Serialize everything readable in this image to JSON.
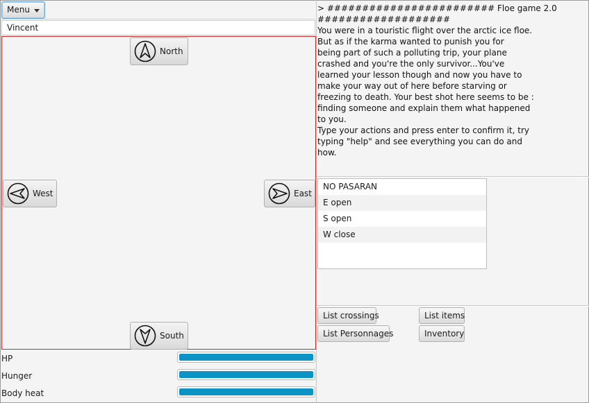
{
  "menu": {
    "label": "Menu"
  },
  "player": {
    "name": "Vincent"
  },
  "map": {
    "north": {
      "label": "North",
      "icon": "arrow-up-icon"
    },
    "south": {
      "label": "South",
      "icon": "arrow-down-icon"
    },
    "west": {
      "label": "West",
      "icon": "arrow-left-icon"
    },
    "east": {
      "label": "East",
      "icon": "arrow-right-icon"
    }
  },
  "stats": [
    {
      "label": "HP",
      "fraction": 1.0
    },
    {
      "label": "Hunger",
      "fraction": 1.0
    },
    {
      "label": "Body heat",
      "fraction": 1.0
    }
  ],
  "log": {
    "text": "> ######################## Floe game 2.0\n###################\nYou were in a touristic flight over the arctic ice floe.\nBut as if the karma wanted to punish you for\nbeing part of such a polluting trip, your plane\ncrashed and you're the only survivor...You've\nlearned your lesson though and now you have to\nmake your way out of here before starving or\nfreezing to death. Your best shot here seems to be :\nfinding someone and explain them what happened\nto you.\nType your actions and press enter to confirm it, try\ntyping \"help\" and see everything you can do and\nhow."
  },
  "exits": [
    "NO PASARAN",
    "E open",
    "S open",
    "W close",
    ""
  ],
  "actions": {
    "list_crossings": "List crossings",
    "list_items": "List items",
    "list_personnages": "List Personnages",
    "inventory": "Inventory"
  },
  "colors": {
    "map_border": "#d22a2a",
    "progress_fill": "#0b93c6",
    "menu_focus": "#6aa8d8"
  }
}
